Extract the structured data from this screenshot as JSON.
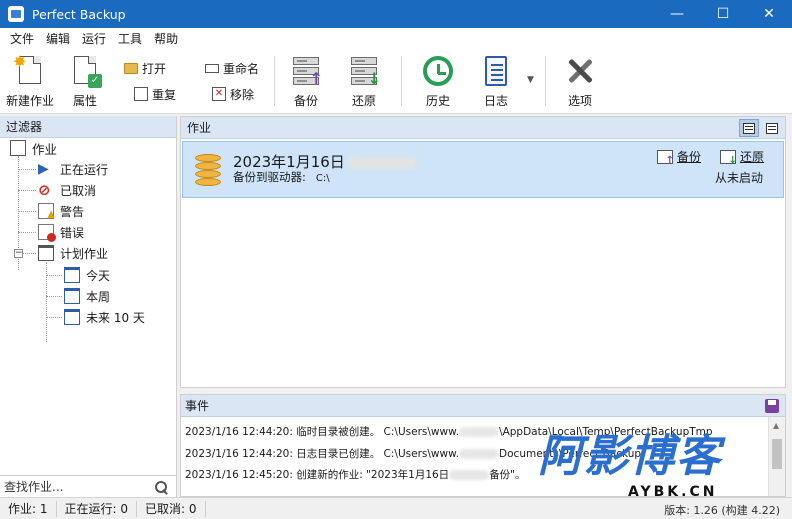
{
  "window": {
    "title": "Perfect Backup",
    "minimize": "—",
    "maximize": "☐",
    "close": "✕"
  },
  "menu": [
    "文件",
    "编辑",
    "运行",
    "工具",
    "帮助"
  ],
  "toolbar": {
    "new_job": "新建作业",
    "properties": "属性",
    "open": "打开",
    "duplicate": "重复",
    "rename": "重命名",
    "remove": "移除",
    "backup": "备份",
    "restore": "还原",
    "history": "历史",
    "log": "日志",
    "options": "选项"
  },
  "filter": {
    "header": "过滤器",
    "items": {
      "jobs": "作业",
      "running": "正在运行",
      "cancelled": "已取消",
      "warning": "警告",
      "error": "错误",
      "scheduled": "计划作业",
      "today": "今天",
      "this_week": "本周",
      "next_10_days": "未来 10 天"
    },
    "search_placeholder": "查找作业..."
  },
  "jobs": {
    "header": "作业",
    "row": {
      "title": "2023年1月16日",
      "subtitle": "备份到驱动器:",
      "path": "C:\\",
      "backup_action": "备份",
      "restore_action": "还原",
      "status": "从未启动"
    }
  },
  "events": {
    "header": "事件",
    "lines": [
      {
        "prefix": "2023/1/16 12:44:20: 临时目录被创建。 C:\\Users\\www.",
        "suffix": "\\AppData\\Local\\Temp\\PerfectBackupTmp"
      },
      {
        "prefix": "2023/1/16 12:44:20: 日志目录已创建。 C:\\Users\\www.",
        "suffix": "Documents\\Perfect Backup"
      },
      {
        "prefix": "2023/1/16 12:45:20: 创建新的作业: \"2023年1月16日",
        "suffix": "备份\"。"
      }
    ]
  },
  "status": {
    "jobs": "作业: 1",
    "running": "正在运行: 0",
    "cancelled": "已取消: 0",
    "version": "版本: 1.26 (构建 4.22)"
  },
  "watermark": {
    "big": "阿影博客",
    "small": "AYBK.CN"
  },
  "colors": {
    "titlebar": "#1a6ac0",
    "selection": "#cfe4f8",
    "panel_header": "#dbe6f4",
    "watermark": "#2a6fd0"
  }
}
